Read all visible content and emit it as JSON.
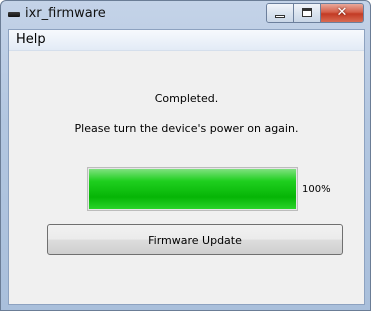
{
  "window": {
    "title": "ixr_firmware",
    "close_glyph": "✕"
  },
  "menu": {
    "items": [
      {
        "label": "Help"
      }
    ]
  },
  "status": {
    "line1": "Completed.",
    "line2": "Please turn the device's power on again."
  },
  "progress": {
    "value": 1.0,
    "label": "100%",
    "color": "#12c412"
  },
  "buttons": {
    "update_label": "Firmware Update"
  }
}
